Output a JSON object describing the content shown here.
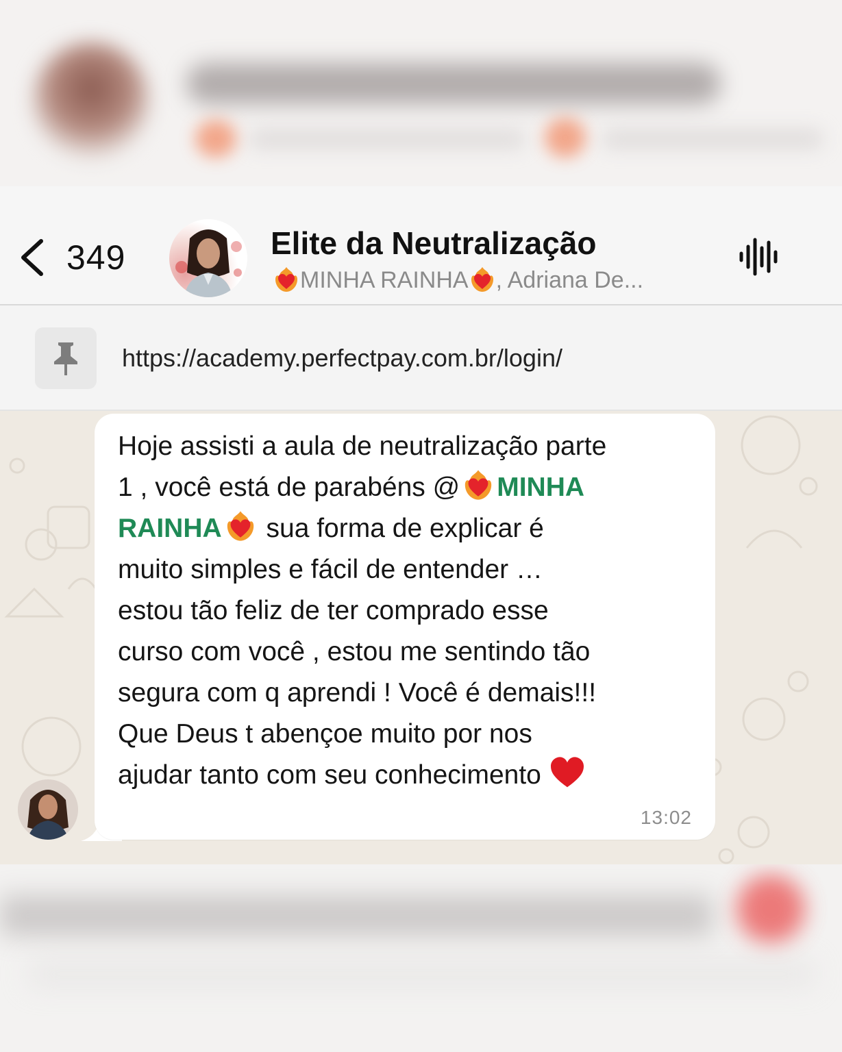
{
  "header": {
    "back_count": "349",
    "group_title": "Elite da Neutralização",
    "subtitle_mention": "MINHA RAINHA",
    "subtitle_rest": ", Adriana De..."
  },
  "pinned": {
    "url": "https://academy.perfectpay.com.br/login/"
  },
  "message": {
    "line1": "Hoje assisti a aula de neutralização parte",
    "line2_prefix": "1 , você está de parabéns @",
    "mention_part1": "MINHA",
    "mention_part2": "RAINHA",
    "line3_rest": " sua forma de explicar é",
    "line4": "muito simples e fácil de entender …",
    "line5": "estou tão feliz de ter comprado esse",
    "line6": "curso com você , estou me sentindo tão",
    "line7": "segura com q aprendi ! Você é demais!!!",
    "line8": "Que Deus t abençoe muito por nos",
    "line9": "ajudar tanto com seu conhecimento",
    "time": "13:02"
  },
  "colors": {
    "mention": "#1f8a56",
    "heart": "#e01b24",
    "chat_bg": "#efeae2"
  },
  "icons": [
    "back-chevron-icon",
    "pin-icon",
    "voice-waveform-icon",
    "heart-on-fire-icon",
    "red-heart-icon"
  ]
}
